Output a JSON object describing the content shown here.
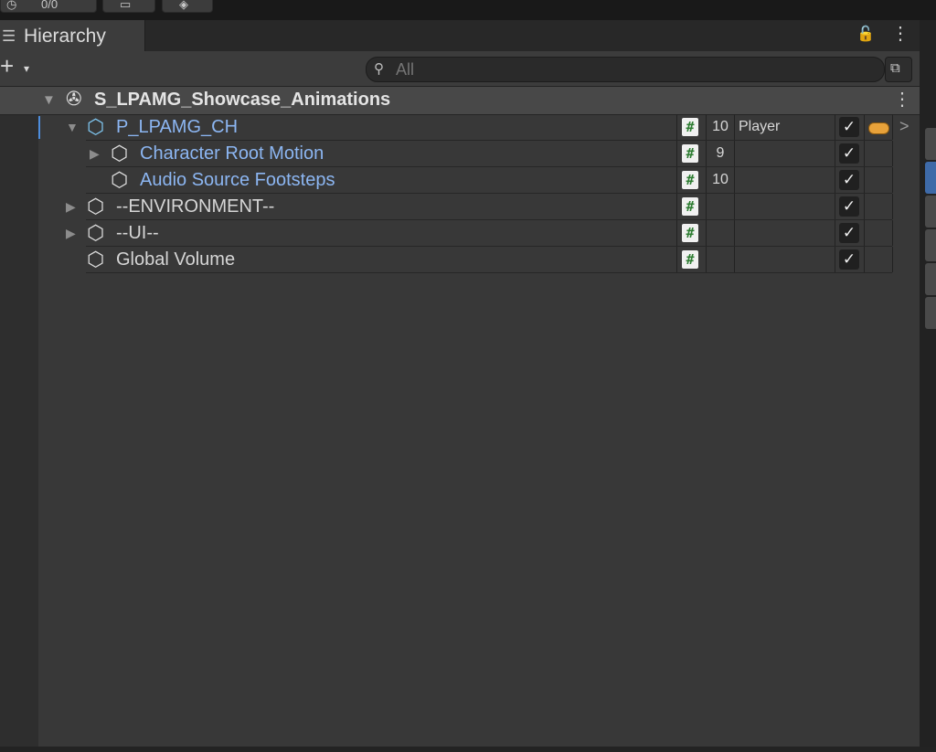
{
  "top_toolbar": [
    {
      "name": "timer-icon",
      "glyph": "◷",
      "label": "0/0"
    },
    {
      "name": "layout-icon",
      "glyph": "▭"
    },
    {
      "name": "services-icon",
      "glyph": "◈"
    }
  ],
  "tab": {
    "icon": "list-icon",
    "glyph": "☰",
    "title": "Hierarchy"
  },
  "header_icons": {
    "lock": "🔓",
    "kebab": "⋮"
  },
  "toolbar": {
    "create_plus": "+",
    "create_drop": "▾",
    "search_glyph": "⚲",
    "search_placeholder": "All",
    "search_side_glyph": "⧉"
  },
  "scene": {
    "name": "S_LPAMG_Showcase_Animations",
    "arrow": "▼",
    "icon": "✇",
    "kebab": "⋮"
  },
  "glyphs": {
    "expanded": "▼",
    "collapsed": "▶",
    "cube": "⬡",
    "hash": "#",
    "check": "✓",
    "chevron": ">"
  },
  "rows": [
    {
      "name": "P_LPAMG_CH",
      "layer": "10",
      "tag": "Player",
      "prefab": true
    },
    {
      "name": "Character Root Motion",
      "layer": "9",
      "tag": "",
      "prefab": true
    },
    {
      "name": "Audio Source Footsteps",
      "layer": "10",
      "tag": "",
      "prefab": true
    },
    {
      "name": "--ENVIRONMENT--",
      "layer": "",
      "tag": "",
      "prefab": false
    },
    {
      "name": "--UI--",
      "layer": "",
      "tag": "",
      "prefab": false
    },
    {
      "name": "Global Volume",
      "layer": "",
      "tag": "",
      "prefab": false
    }
  ],
  "colors": {
    "prefab_text": "#8cb6f2",
    "selection_bar": "#4d8ddc",
    "static_pill": "#e8a23a",
    "script_hash": "#2e7d32"
  }
}
